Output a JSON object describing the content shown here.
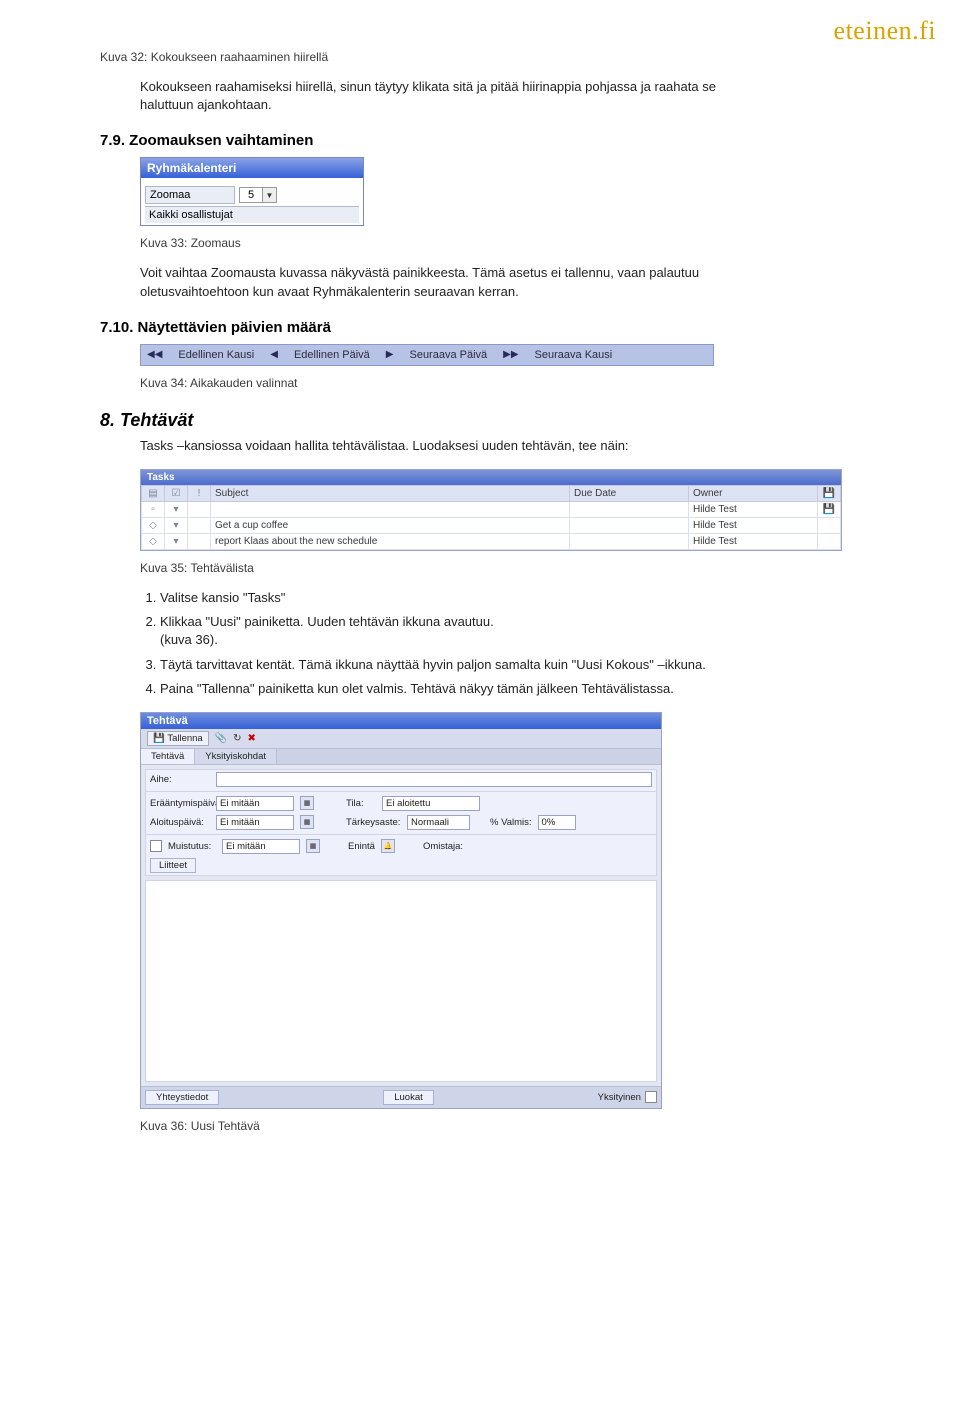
{
  "logo": "eteinen.fi",
  "caption32": "Kuva 32: Kokoukseen raahaaminen hiirellä",
  "para32": "Kokoukseen raahamiseksi hiirellä, sinun täytyy klikata sitä ja pitää hiirinappia pohjassa ja raahata se haluttuun ajankohtaan.",
  "sec79": "7.9. Zoomauksen vaihtaminen",
  "rk": {
    "title": "Ryhmäkalenteri",
    "zoom_label": "Zoomaa",
    "zoom_value": "5",
    "participants": "Kaikki osallistujat"
  },
  "caption33": "Kuva 33: Zoomaus",
  "para33": "Voit vaihtaa Zoomausta kuvassa näkyvästä painikkeesta. Tämä asetus ei tallennu, vaan palautuu oletusvaihtoehtoon kun avaat Ryhmäkalenterin seuraavan kerran.",
  "sec710": "7.10. Näytettävien päivien määrä",
  "nav": {
    "prev_period": "Edellinen Kausi",
    "prev_day": "Edellinen Päivä",
    "next_day": "Seuraava Päivä",
    "next_period": "Seuraava Kausi"
  },
  "caption34": "Kuva 34: Aikakauden valinnat",
  "sec8": "8. Tehtävät",
  "para8": "Tasks –kansiossa voidaan hallita tehtävälistaa. Luodaksesi uuden tehtävän, tee näin:",
  "tasks": {
    "title": "Tasks",
    "col_subject": "Subject",
    "col_due": "Due Date",
    "col_owner": "Owner",
    "rows": [
      {
        "subject": "",
        "owner": "Hilde Test"
      },
      {
        "subject": "Get a cup coffee",
        "owner": "Hilde Test"
      },
      {
        "subject": "report Klaas about the new schedule",
        "owner": "Hilde Test"
      }
    ]
  },
  "caption35": "Kuva 35: Tehtävälista",
  "steps": {
    "s1": "Valitse kansio \"Tasks\"",
    "s2a": "Klikkaa \"Uusi\" painiketta. Uuden tehtävän ikkuna avautuu.",
    "s2b": "(kuva 36).",
    "s3": "Täytä tarvittavat kentät. Tämä ikkuna näyttää hyvin paljon samalta kuin \"Uusi Kokous\" –ikkuna.",
    "s4": "Paina \"Tallenna\" painiketta kun olet valmis. Tehtävä näkyy tämän jälkeen Tehtävälistassa."
  },
  "editor": {
    "title": "Tehtävä",
    "save": "Tallenna",
    "tab1": "Tehtävä",
    "tab2": "Yksityiskohdat",
    "lbl_subject": "Aihe:",
    "lbl_due": "Erääntymispäivä:",
    "lbl_start": "Aloituspäivä:",
    "lbl_reminder": "Muistutus:",
    "lbl_attachments": "Liitteet",
    "lbl_status": "Tila:",
    "lbl_priority": "Tärkeysaste:",
    "lbl_pctdone": "% Valmis:",
    "lbl_until": "Enintä",
    "lbl_owner": "Omistaja:",
    "val_none": "Ei mitään",
    "val_status": "Ei aloitettu",
    "val_priority": "Normaali",
    "val_pct": "0%",
    "btn_contacts": "Yhteystiedot",
    "btn_categories": "Luokat",
    "lbl_private": "Yksityinen"
  },
  "caption36": "Kuva 36: Uusi Tehtävä"
}
